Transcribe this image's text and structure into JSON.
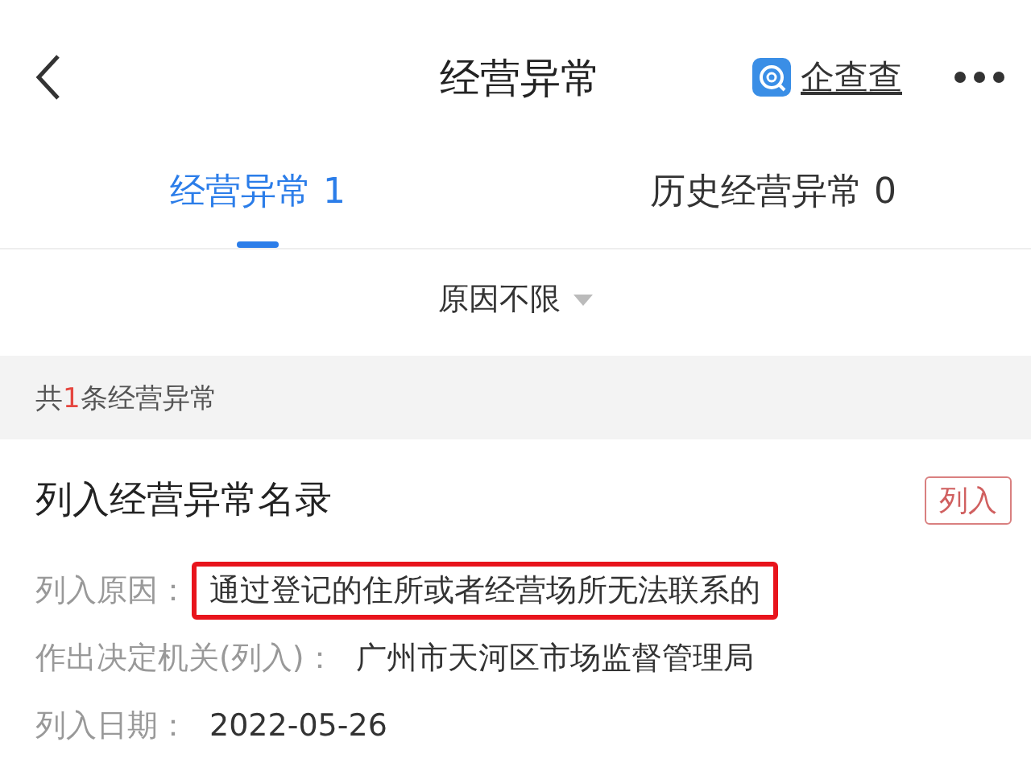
{
  "header": {
    "title": "经营异常",
    "brand": "企查查"
  },
  "tabs": [
    {
      "label": "经营异常 1",
      "selected": true
    },
    {
      "label": "历史经营异常 0",
      "selected": false
    }
  ],
  "filter": {
    "label": "原因不限"
  },
  "summary": {
    "prefix": "共",
    "count": "1",
    "suffix": "条经营异常"
  },
  "record": {
    "title": "列入经营异常名录",
    "tag": "列入",
    "fields": [
      {
        "label": "列入原因：",
        "value": "通过登记的住所或者经营场所无法联系的",
        "highlighted": true
      },
      {
        "label": "作出决定机关(列入)：",
        "value": "广州市天河区市场监督管理局",
        "highlighted": false
      },
      {
        "label": "列入日期：",
        "value": "2022-05-26",
        "highlighted": false
      }
    ]
  }
}
